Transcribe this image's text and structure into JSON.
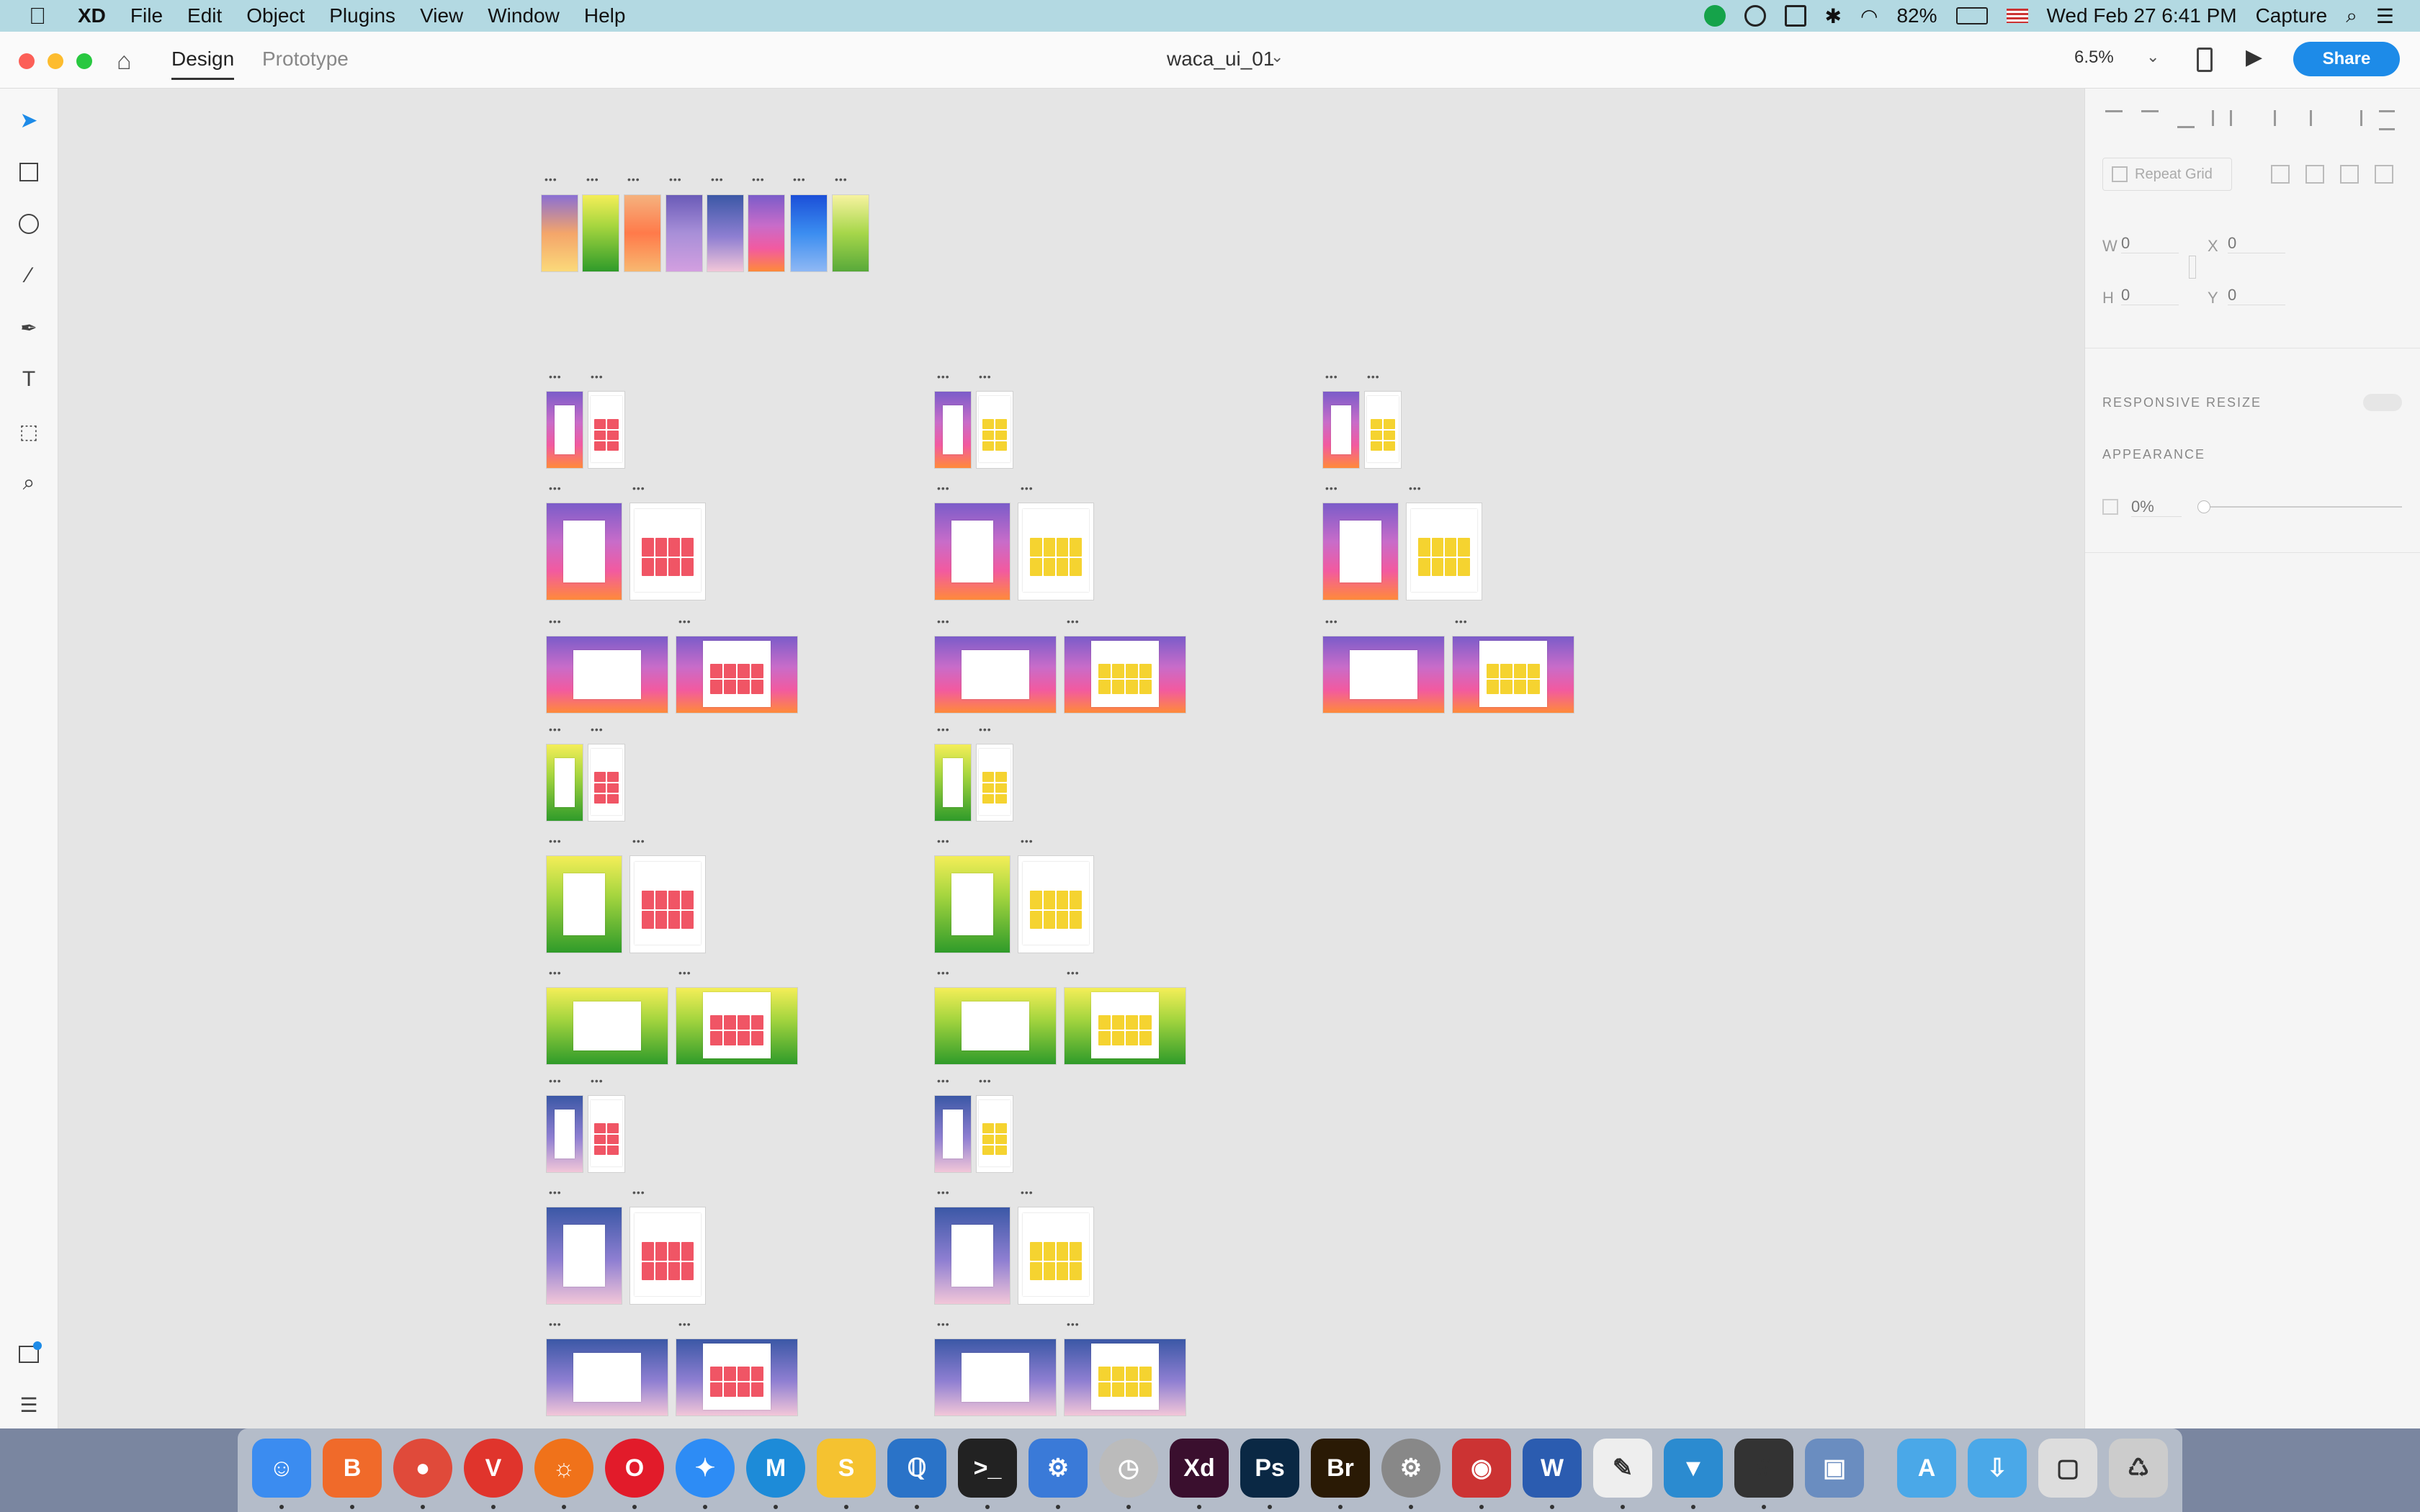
{
  "menubar": {
    "app_name": "XD",
    "items": [
      "File",
      "Edit",
      "Object",
      "Plugins",
      "View",
      "Window",
      "Help"
    ],
    "battery": "82%",
    "datetime": "Wed Feb 27  6:41 PM",
    "capture": "Capture"
  },
  "titlebar": {
    "tab_design": "Design",
    "tab_prototype": "Prototype",
    "document_title": "waca_ui_01",
    "zoom": "6.5%",
    "share": "Share"
  },
  "panel": {
    "repeat_grid": "Repeat Grid",
    "w_label": "W",
    "w_value": "0",
    "x_label": "X",
    "x_value": "0",
    "h_label": "H",
    "h_value": "0",
    "y_label": "Y",
    "y_value": "0",
    "responsive_resize": "RESPONSIVE RESIZE",
    "appearance": "APPEARANCE",
    "opacity": "0%"
  },
  "artboard_label": "•••",
  "dock_apps": [
    "Finder",
    "Brave",
    "Chrome",
    "Vivaldi",
    "Firefox",
    "Opera",
    "Safari",
    "MarkDown",
    "Slack",
    "VS Code",
    "Terminal",
    "Xcode",
    "Time Machine",
    "Xd",
    "Ps",
    "Br",
    "System Preferences",
    "Photo Booth",
    "Word",
    "TextEdit",
    "Keynote",
    "Calculator",
    "Preview",
    "Applications",
    "Downloads",
    "Screenshot",
    "Trash"
  ],
  "colors": {
    "accent": "#1d8be8",
    "menubar": "#b3d9e2"
  }
}
